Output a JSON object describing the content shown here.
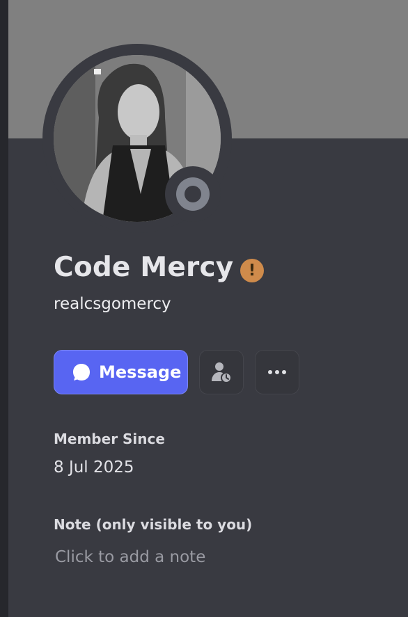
{
  "profile": {
    "display_name": "Code Mercy",
    "username": "realcsgomercy",
    "badge_icon": "warning-icon",
    "status": "offline"
  },
  "actions": {
    "message_label": "Message",
    "message_icon": "chat-bubble-icon",
    "friend_icon": "pending-friend-icon",
    "more_icon": "more-dots-icon"
  },
  "member_since": {
    "title": "Member Since",
    "date": "8 Jul 2025"
  },
  "note": {
    "title": "Note (only visible to you)",
    "placeholder": "Click to add a note",
    "value": ""
  },
  "colors": {
    "background": "#393a41",
    "banner": "#808080",
    "accent": "#5865f2",
    "warning": "#cf8b4b",
    "status_offline": "#80848e"
  }
}
